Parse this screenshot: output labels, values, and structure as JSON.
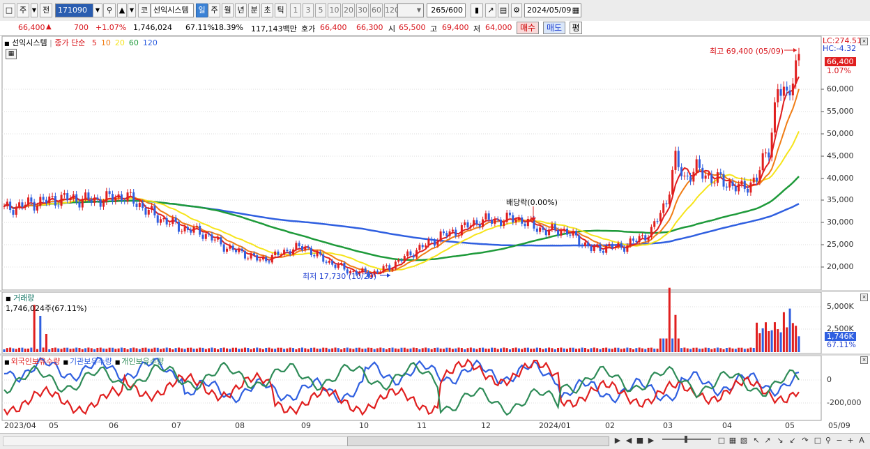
{
  "toolbar": {
    "market": "코",
    "tab1": "주",
    "tab2": "전",
    "code": "171090",
    "stock_name": "선익시스템",
    "periods": [
      "일",
      "주",
      "월",
      "년",
      "분",
      "초",
      "틱"
    ],
    "selected_period": "일",
    "intervals": [
      "1",
      "3",
      "5",
      "10",
      "20",
      "30",
      "60",
      "120"
    ],
    "count": "265/600",
    "date": "2024/05/09"
  },
  "quote": {
    "price": "66,400",
    "change_arrow": "▲",
    "change": "700",
    "change_pct": "+1.07%",
    "volume": "1,746,024",
    "vol_pct": "67.11%",
    "turnover": "18.39%",
    "amount": "117,143백만",
    "hoga_label": "호가",
    "ask": "66,400",
    "bid": "66,300",
    "open_label": "시",
    "open": "65,500",
    "high_label": "고",
    "high": "69,400",
    "low_label": "저",
    "low": "64,000",
    "buy_button": "매수",
    "sell_button": "매도",
    "avg_button": "평"
  },
  "price_panel": {
    "title": "선익시스템",
    "ma_label": "종가 단순",
    "ma_periods": [
      "5",
      "10",
      "20",
      "60",
      "120"
    ],
    "ma_colors": [
      "#e01f1f",
      "#f07c14",
      "#f6e41a",
      "#1e9a3a",
      "#2f5fe0"
    ],
    "lc": "LC:274.51",
    "hc": "HC:-4.32",
    "last_price": "66,400",
    "last_pct": "1.07%",
    "high_note": "최고 69,400 (05/09)",
    "low_note": "최저 17,730 (10/20)",
    "dividend_note": "배당락(0.00%)",
    "y_ticks": [
      "60,000",
      "55,000",
      "50,000",
      "45,000",
      "40,000",
      "35,000",
      "30,000",
      "25,000",
      "20,000"
    ]
  },
  "volume_panel": {
    "title": "거래량",
    "value": "1,746,024주(67.11%)",
    "y_ticks": [
      "5,000K",
      "2,500K"
    ],
    "last_value": "1,746K",
    "last_pct": "67.11%"
  },
  "holdings_panel": {
    "series": [
      {
        "name": "외국인보유수량",
        "color": "#e01f1f"
      },
      {
        "name": "기관보유수량",
        "color": "#2f5fe0"
      },
      {
        "name": "개인보유수량",
        "color": "#2e8b57"
      }
    ],
    "y_ticks": [
      "0",
      "-200,000"
    ]
  },
  "x_axis": [
    "2023/04",
    "05",
    "06",
    "07",
    "08",
    "09",
    "10",
    "11",
    "12",
    "2024/01",
    "02",
    "03",
    "04",
    "05",
    "05/09"
  ],
  "icons": {
    "window": "window-icon",
    "search": "search-icon",
    "sound": "speaker-icon",
    "calendar": "calendar-icon",
    "settings": "gear-icon",
    "save": "save-icon"
  }
}
